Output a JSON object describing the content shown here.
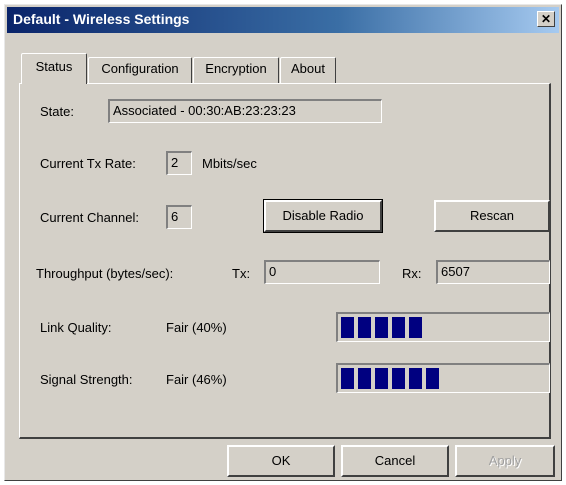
{
  "window": {
    "title": "Default - Wireless Settings",
    "close_glyph": "✕"
  },
  "tabs": [
    {
      "label": "Status",
      "active": true
    },
    {
      "label": "Configuration",
      "active": false
    },
    {
      "label": "Encryption",
      "active": false
    },
    {
      "label": "About",
      "active": false
    }
  ],
  "status": {
    "state_label": "State:",
    "state_value": "Associated - 00:30:AB:23:23:23",
    "tx_rate_label": "Current Tx Rate:",
    "tx_rate_value": "2",
    "tx_rate_unit": "Mbits/sec",
    "channel_label": "Current Channel:",
    "channel_value": "6",
    "disable_radio_label": "Disable Radio",
    "rescan_label": "Rescan",
    "throughput_label": "Throughput (bytes/sec):",
    "tx_label": "Tx:",
    "tx_value": "0",
    "rx_label": "Rx:",
    "rx_value": "6507",
    "link_quality_label": "Link Quality:",
    "link_quality_value": "Fair (40%)",
    "link_quality_percent": 40,
    "signal_strength_label": "Signal Strength:",
    "signal_strength_value": "Fair (46%)",
    "signal_strength_percent": 46
  },
  "buttons": {
    "ok": "OK",
    "cancel": "Cancel",
    "apply": "Apply"
  },
  "colors": {
    "meter_fill": "#000080",
    "titlebar": "#0a246a"
  }
}
